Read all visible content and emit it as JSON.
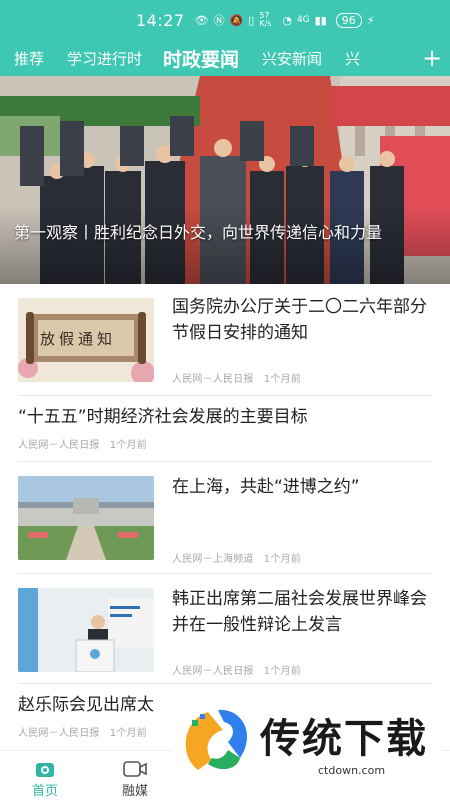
{
  "status_bar": {
    "time": "14:27",
    "signal_text": "4G",
    "network_speed": "57 K/s",
    "battery": "96"
  },
  "tabs": {
    "items": [
      {
        "label": "推荐"
      },
      {
        "label": "学习进行时"
      },
      {
        "label": "时政要闻"
      },
      {
        "label": "兴安新闻"
      },
      {
        "label": "兴"
      }
    ],
    "active_index": 2,
    "add_icon": "plus-icon"
  },
  "hero": {
    "caption": "第一观察丨胜利纪念日外交，向世界传递信心和力量"
  },
  "feed": [
    {
      "title": "国务院办公厅关于二〇二六年部分节假日安排的通知",
      "meta": "人民网－人民日报　1个月前",
      "thumb": "scroll-notice-image",
      "thumb_text": "放假通知"
    },
    {
      "title": "“十五五”时期经济社会发展的主要目标",
      "meta": "人民网－人民日报　1个月前"
    },
    {
      "title": "在上海，共赴“进博之约”",
      "meta": "人民网－上海频道　1个月前",
      "thumb": "expo-building-image"
    },
    {
      "title": "韩正出席第二届社会发展世界峰会并在一般性辩论上发言",
      "meta": "人民网－人民日报　1个月前",
      "thumb": "podium-speech-image"
    },
    {
      "title": "赵乐际会见出席太",
      "meta": "人民网－人民日报　1个月前"
    }
  ],
  "bottom_nav": {
    "items": [
      {
        "label": "首页",
        "icon": "home-icon"
      },
      {
        "label": "融媒",
        "icon": "video-icon"
      }
    ],
    "active_index": 0
  },
  "watermark": {
    "text": "传统下载",
    "url": "ctdown.com"
  },
  "colors": {
    "brand": "#3ec7b2",
    "active_nav": "#2fb7a1"
  }
}
